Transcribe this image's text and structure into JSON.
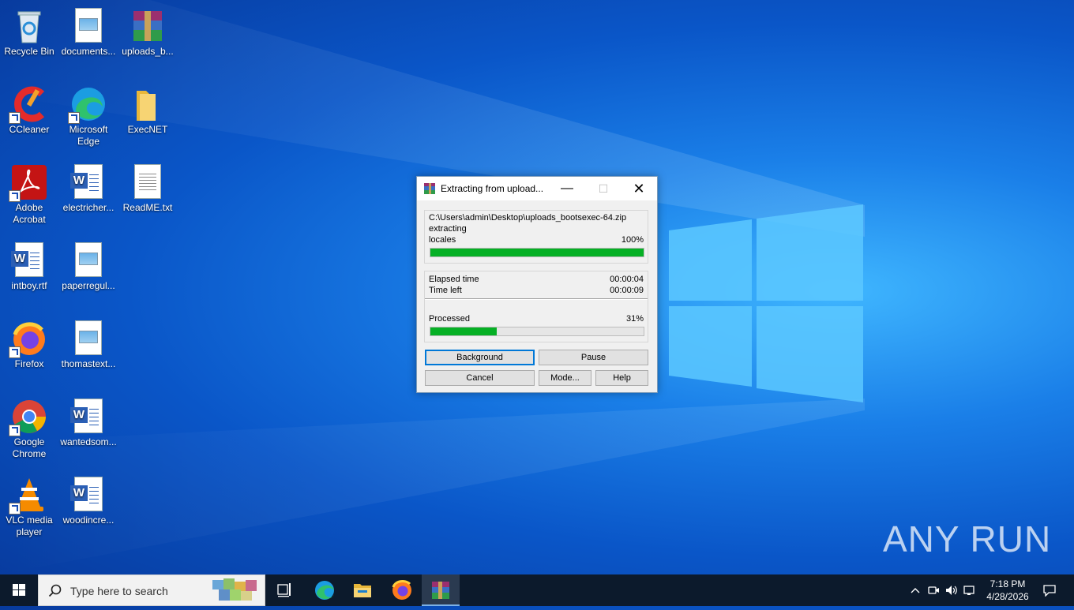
{
  "desktop": {
    "icons": [
      {
        "label": "Recycle Bin",
        "icon": "recycle-bin-icon"
      },
      {
        "label": "documents...",
        "icon": "image-file-icon"
      },
      {
        "label": "uploads_b...",
        "icon": "winrar-archive-icon"
      },
      {
        "label": "CCleaner",
        "icon": "ccleaner-icon"
      },
      {
        "label": "Microsoft Edge",
        "icon": "edge-icon"
      },
      {
        "label": "ExecNET",
        "icon": "folder-icon"
      },
      {
        "label": "Adobe Acrobat",
        "icon": "acrobat-icon"
      },
      {
        "label": "electricher...",
        "icon": "word-doc-icon"
      },
      {
        "label": "ReadME.txt",
        "icon": "text-file-icon"
      },
      {
        "label": "intboy.rtf",
        "icon": "word-doc-icon"
      },
      {
        "label": "paperregul...",
        "icon": "image-file-icon"
      },
      {
        "label": "Firefox",
        "icon": "firefox-icon"
      },
      {
        "label": "thomastext...",
        "icon": "image-file-icon"
      },
      {
        "label": "Google Chrome",
        "icon": "chrome-icon"
      },
      {
        "label": "wantedsom...",
        "icon": "word-doc-icon"
      },
      {
        "label": "VLC media player",
        "icon": "vlc-icon"
      },
      {
        "label": "woodincre...",
        "icon": "word-doc-icon"
      }
    ]
  },
  "dialog": {
    "title": "Extracting from upload...",
    "path": "C:\\Users\\admin\\Desktop\\uploads_bootsexec-64.zip",
    "action": "extracting",
    "current_file": "locales",
    "file_percent": "100%",
    "file_progress": 1.0,
    "elapsed_label": "Elapsed time",
    "elapsed_value": "00:00:04",
    "left_label": "Time left",
    "left_value": "00:00:09",
    "processed_label": "Processed",
    "processed_percent": "31%",
    "processed_progress": 0.31,
    "buttons": {
      "background": "Background",
      "pause": "Pause",
      "cancel": "Cancel",
      "mode": "Mode...",
      "help": "Help"
    },
    "title_buttons": {
      "minimize": "—",
      "maximize": "☐",
      "close": "✕"
    }
  },
  "taskbar": {
    "search_placeholder": "Type here to search",
    "clock_time": "7:18 PM",
    "clock_date": "4/28/2026",
    "apps": [
      "task-view-icon",
      "edge-icon",
      "file-explorer-icon",
      "firefox-icon",
      "winrar-icon"
    ]
  },
  "watermark": "ANY RUN",
  "colors": {
    "progress_green": "#06b025",
    "taskbar": "#0c1a2c",
    "accent": "#0078d7"
  }
}
